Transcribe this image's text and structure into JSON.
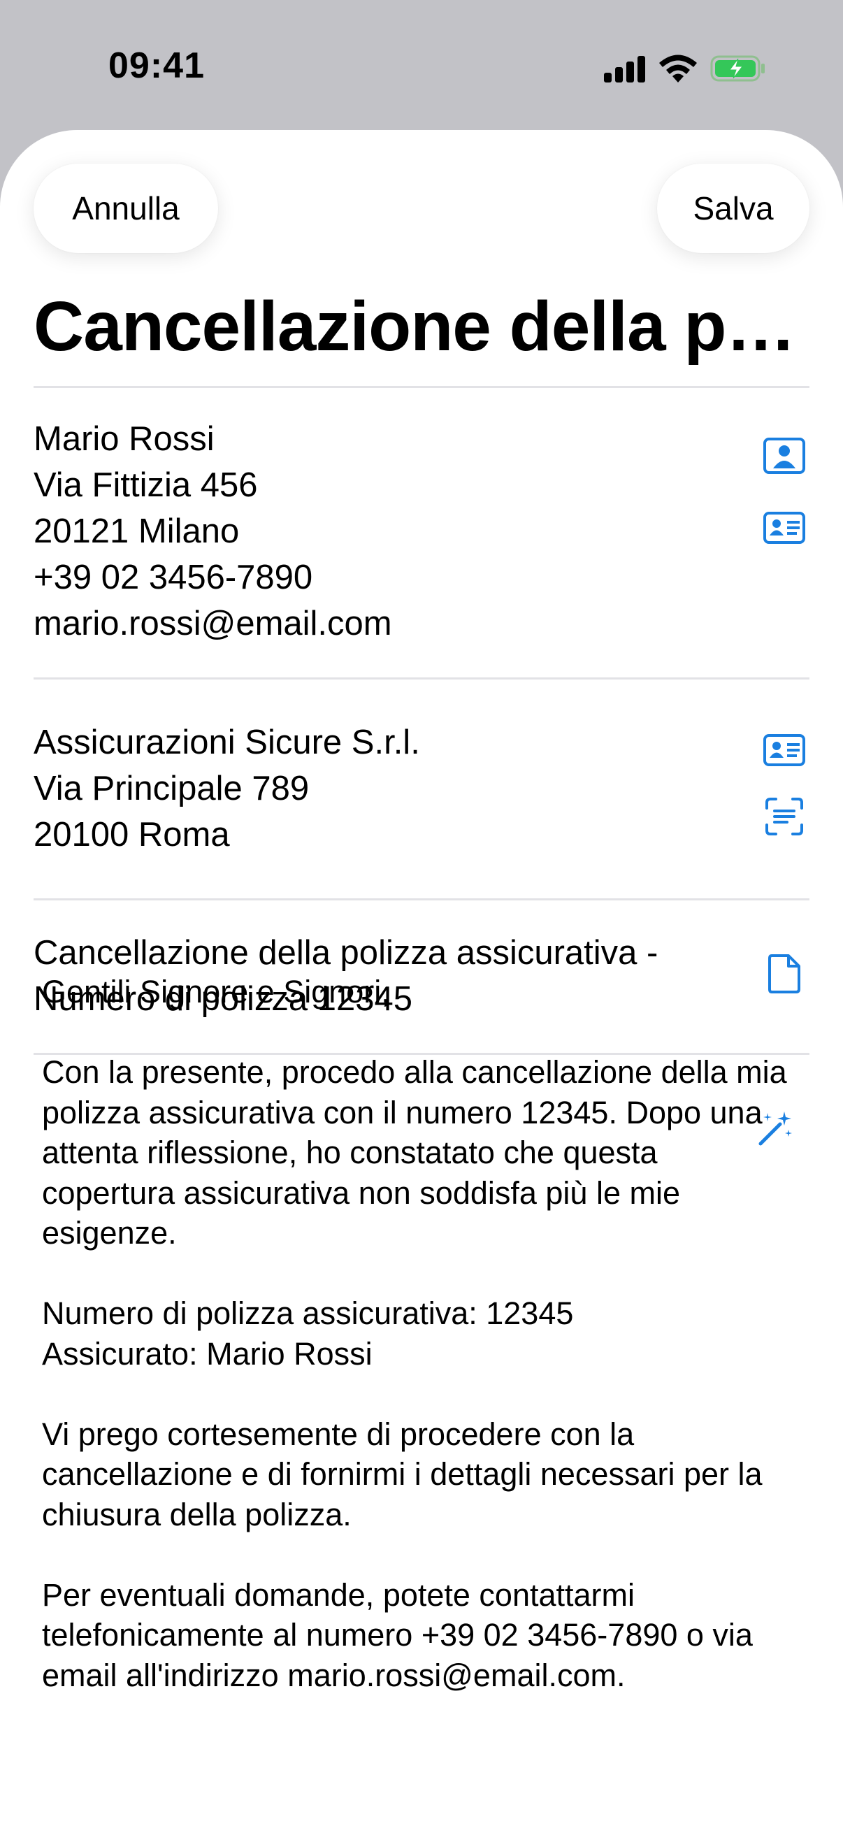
{
  "status_bar": {
    "time": "09:41"
  },
  "nav": {
    "cancel_label": "Annulla",
    "save_label": "Salva"
  },
  "title": "Cancellazione della polizza assicurativa",
  "sender": {
    "lines": [
      "Mario Rossi",
      "Via Fittizia 456",
      "20121 Milano",
      "+39 02 3456-7890",
      "mario.rossi@email.com"
    ]
  },
  "recipient": {
    "lines": [
      "Assicurazioni Sicure S.r.l.",
      "Via Principale 789",
      "20100 Roma"
    ]
  },
  "subject": {
    "lines": [
      "Cancellazione della polizza assicurativa -",
      "Numero di polizza 12345"
    ]
  },
  "letter": {
    "greeting": "Gentili Signore e Signori,",
    "p1": "Con la presente, procedo alla cancellazione della mia polizza assicurativa con il numero 12345. Dopo una attenta riflessione, ho constatato che questa copertura assicurativa non soddisfa più le mie esigenze.",
    "p2_line1": "Numero di polizza assicurativa: 12345",
    "p2_line2": "Assicurato: Mario Rossi",
    "p3": "Vi prego cortesemente di procedere con la cancellazione e di fornirmi i dettagli necessari per la chiusura della polizza.",
    "p4": "Per eventuali domande, potete contattarmi telefonicamente al numero +39 02 3456-7890 o via email all'indirizzo mario.rossi@email.com."
  },
  "icons": {
    "accent_color": "#1a7fe0",
    "sender_icons": [
      "person-photo-icon",
      "contact-card-icon"
    ],
    "recipient_icons": [
      "contact-card-icon",
      "text-scan-icon"
    ],
    "subject_icon": "document-icon",
    "letter_icon": "magic-wand-icon"
  }
}
